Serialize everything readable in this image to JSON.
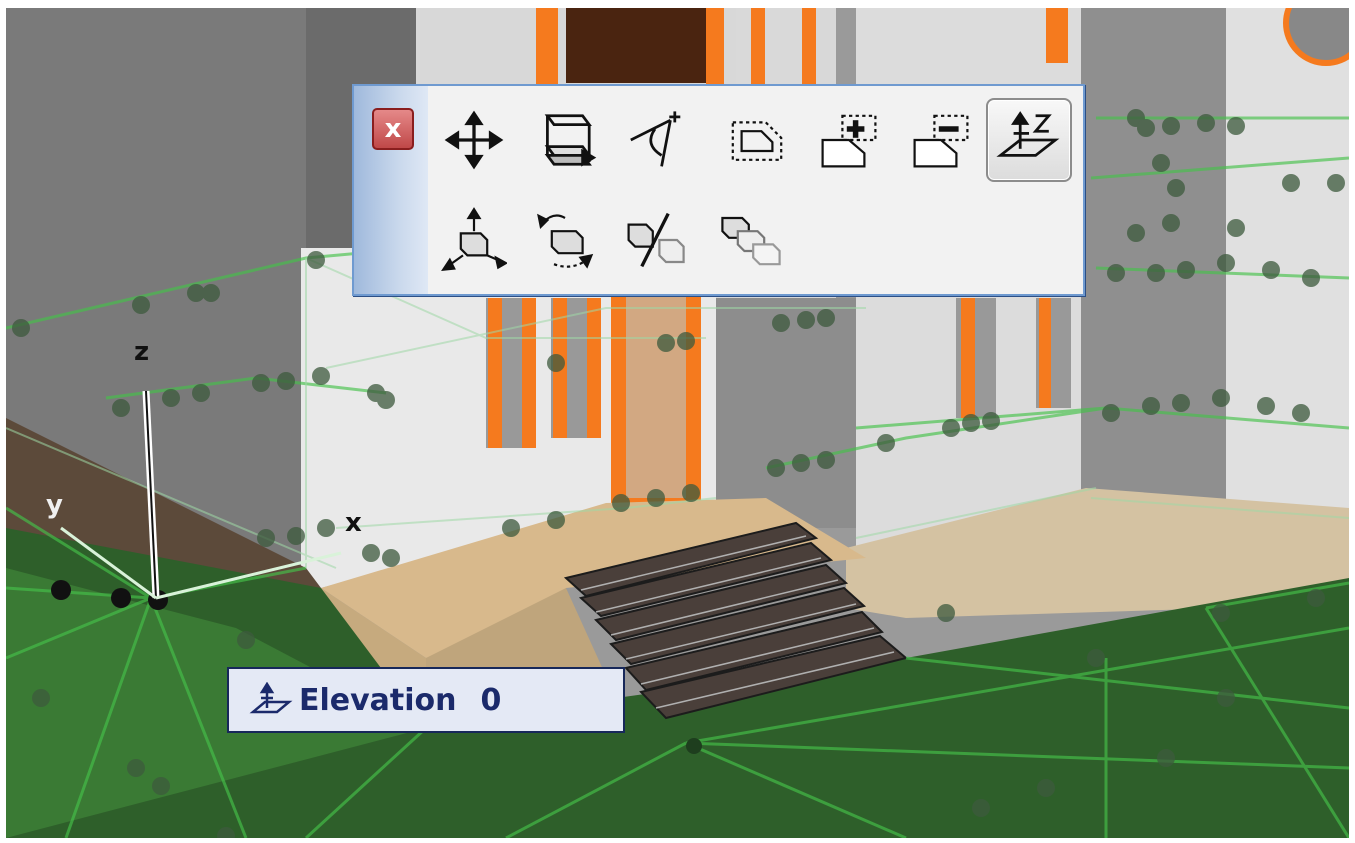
{
  "palette": {
    "close_glyph": "x",
    "tools_row1": [
      {
        "icon": "move-arrows-icon"
      },
      {
        "icon": "elevate-layers-icon"
      },
      {
        "icon": "rotate-angle-icon"
      },
      {
        "icon": "offset-outline-icon"
      },
      {
        "icon": "add-polygon-icon"
      },
      {
        "icon": "subtract-polygon-icon"
      },
      {
        "icon": "z-elevation-icon",
        "active": true
      }
    ],
    "tools_row2": [
      {
        "icon": "drag-copy-3d-icon"
      },
      {
        "icon": "rotate-copy-3d-icon"
      },
      {
        "icon": "mirror-copy-icon"
      },
      {
        "icon": "multiply-copy-icon"
      }
    ]
  },
  "axes": {
    "z": "z",
    "x": "x",
    "y": "y"
  },
  "elevation_tooltip": {
    "label": "Elevation",
    "value": "0",
    "icon": "elevation-icon"
  },
  "colors": {
    "accent_orange": "#f57a1e",
    "mesh_green": "#45c24a",
    "ground_green": "#2e5f2a",
    "palette_border": "#6f9ad0"
  }
}
